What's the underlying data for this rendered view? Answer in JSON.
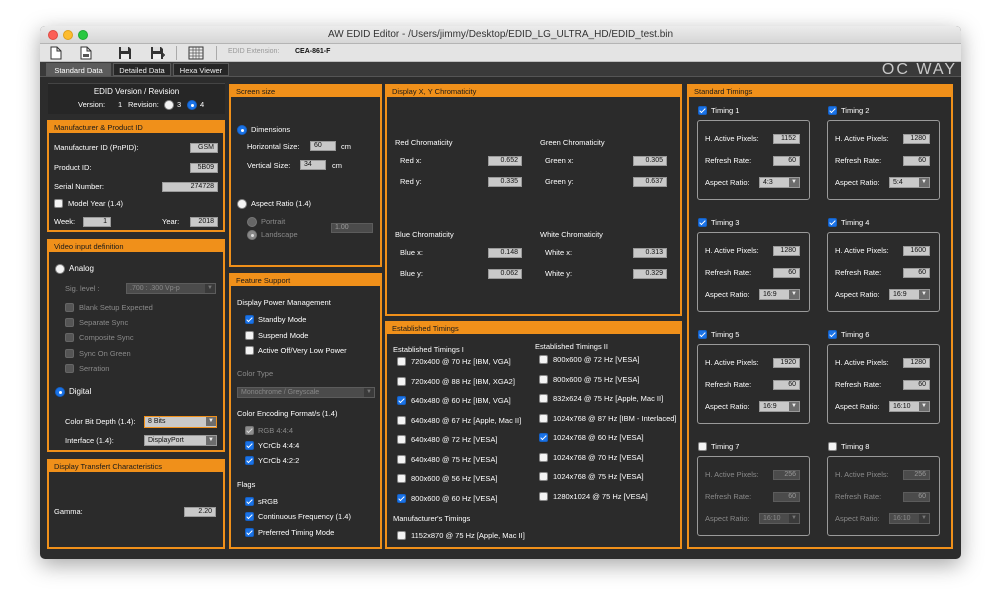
{
  "window": {
    "title": "AW EDID Editor - /Users/jimmy/Desktop/EDID_LG_ULTRA_HD/EDID_test.bin",
    "extension_label": "EDID Extension:",
    "extension_value": "CEA-861-F"
  },
  "tabs": [
    "Standard Data",
    "Detailed Data",
    "Hexa Viewer"
  ],
  "logo": "OC WAY",
  "edid_version": {
    "title": "EDID Version / Revision",
    "version_label": "Version:",
    "version_value": "1",
    "revision_label": "Revision:",
    "rev3": "3",
    "rev4": "4"
  },
  "manufacturer": {
    "title": "Manufacturer & Product ID",
    "id_label": "Manufacturer ID (PnPID):",
    "id_value": "GSM",
    "product_label": "Product ID:",
    "product_value": "5B09",
    "serial_label": "Serial Number:",
    "serial_value": "274728",
    "model_year_label": "Model Year (1.4)",
    "week_label": "Week:",
    "week_value": "1",
    "year_label": "Year:",
    "year_value": "2018"
  },
  "video_input": {
    "title": "Video input definition",
    "analog_label": "Analog",
    "sig_label": "Sig. level :",
    "sig_value": ".700 : .300 Vp-p",
    "blank": "Blank Setup Expected",
    "separate": "Separate Sync",
    "composite": "Composite Sync",
    "sync_green": "Sync On Green",
    "serration": "Serration",
    "digital_label": "Digital",
    "bit_depth_label": "Color Bit Depth (1.4):",
    "bit_depth_value": "8 Bits",
    "interface_label": "Interface (1.4):",
    "interface_value": "DisplayPort"
  },
  "display_transfer": {
    "title": "Display Transfert Characteristics",
    "gamma_label": "Gamma:",
    "gamma_value": "2.20"
  },
  "screen_size": {
    "title": "Screen size",
    "dimensions_label": "Dimensions",
    "h_label": "Horizontal Size:",
    "h_value": "60",
    "h_unit": "cm",
    "v_label": "Vertical Size:",
    "v_value": "34",
    "v_unit": "cm",
    "aspect_label": "Aspect Ratio (1.4)",
    "portrait": "Portrait",
    "landscape": "Landscape",
    "aspect_value": "1.00"
  },
  "feature": {
    "title": "Feature Support",
    "dpm_label": "Display Power Management",
    "standby": "Standby Mode",
    "suspend": "Suspend Mode",
    "active_off": "Active Off/Very Low Power",
    "color_type_label": "Color Type",
    "color_type_value": "Monochrome / Greyscale",
    "encoding_label": "Color Encoding Format/s (1.4)",
    "rgb444": "RGB 4:4:4",
    "ycrcb444": "YCrCb 4:4:4",
    "ycrcb422": "YCrCb 4:2:2",
    "flags_label": "Flags",
    "srgb": "sRGB",
    "continuous": "Continuous Frequency (1.4)",
    "preferred": "Preferred Timing Mode"
  },
  "chromaticity": {
    "title": "Display X, Y Chromaticity",
    "red_title": "Red Chromaticity",
    "red_x_label": "Red x:",
    "red_x": "0.652",
    "red_y_label": "Red y:",
    "red_y": "0.335",
    "green_title": "Green Chromaticity",
    "green_x_label": "Green x:",
    "green_x": "0.305",
    "green_y_label": "Green y:",
    "green_y": "0.637",
    "blue_title": "Blue Chromaticity",
    "blue_x_label": "Blue x:",
    "blue_x": "0.148",
    "blue_y_label": "Blue y:",
    "blue_y": "0.062",
    "white_title": "White Chromaticity",
    "white_x_label": "White x:",
    "white_x": "0.313",
    "white_y_label": "White y:",
    "white_y": "0.329"
  },
  "established": {
    "title": "Established Timings",
    "col1_title": "Established Timings I",
    "col1": [
      {
        "label": "720x400 @ 70 Hz [IBM, VGA]",
        "checked": false
      },
      {
        "label": "720x400 @ 88 Hz [IBM, XGA2]",
        "checked": false
      },
      {
        "label": "640x480 @ 60 Hz [IBM, VGA]",
        "checked": true
      },
      {
        "label": "640x480 @ 67 Hz [Apple, Mac II]",
        "checked": false
      },
      {
        "label": "640x480 @ 72 Hz [VESA]",
        "checked": false
      },
      {
        "label": "640x480 @ 75 Hz [VESA]",
        "checked": false
      },
      {
        "label": "800x600 @ 56 Hz [VESA]",
        "checked": false
      },
      {
        "label": "800x600 @ 60 Hz [VESA]",
        "checked": true
      }
    ],
    "col2_title": "Established Timings II",
    "col2": [
      {
        "label": "800x600 @ 72 Hz [VESA]",
        "checked": false
      },
      {
        "label": "800x600 @ 75 Hz [VESA]",
        "checked": false
      },
      {
        "label": "832x624 @ 75 Hz [Apple, Mac II]",
        "checked": false
      },
      {
        "label": "1024x768 @ 87 Hz [IBM - Interlaced]",
        "checked": false
      },
      {
        "label": "1024x768 @ 60 Hz [VESA]",
        "checked": true
      },
      {
        "label": "1024x768 @ 70 Hz [VESA]",
        "checked": false
      },
      {
        "label": "1024x768 @ 75 Hz [VESA]",
        "checked": false
      },
      {
        "label": "1280x1024 @ 75 Hz [VESA]",
        "checked": false
      }
    ],
    "mfr_title": "Manufacturer's Timings",
    "mfr_item": "1152x870 @ 75 Hz [Apple, Mac II]"
  },
  "standard_timings": {
    "title": "Standard Timings",
    "hap_label": "H. Active Pixels:",
    "rr_label": "Refresh Rate:",
    "ar_label": "Aspect Ratio:",
    "timings": [
      {
        "name": "Timing 1",
        "enabled": true,
        "hap": "1152",
        "rr": "60",
        "ar": "4:3"
      },
      {
        "name": "Timing 2",
        "enabled": true,
        "hap": "1280",
        "rr": "60",
        "ar": "5:4"
      },
      {
        "name": "Timing 3",
        "enabled": true,
        "hap": "1280",
        "rr": "60",
        "ar": "16:9"
      },
      {
        "name": "Timing 4",
        "enabled": true,
        "hap": "1600",
        "rr": "60",
        "ar": "16:9"
      },
      {
        "name": "Timing 5",
        "enabled": true,
        "hap": "1920",
        "rr": "60",
        "ar": "16:9"
      },
      {
        "name": "Timing 6",
        "enabled": true,
        "hap": "1280",
        "rr": "60",
        "ar": "16:10"
      },
      {
        "name": "Timing 7",
        "enabled": false,
        "hap": "256",
        "rr": "60",
        "ar": "16:10"
      },
      {
        "name": "Timing 8",
        "enabled": false,
        "hap": "256",
        "rr": "60",
        "ar": "16:10"
      }
    ]
  },
  "colors": {
    "accent": "#f0901a",
    "background": "#2b2b2b",
    "check_blue": "#1a73e8"
  }
}
